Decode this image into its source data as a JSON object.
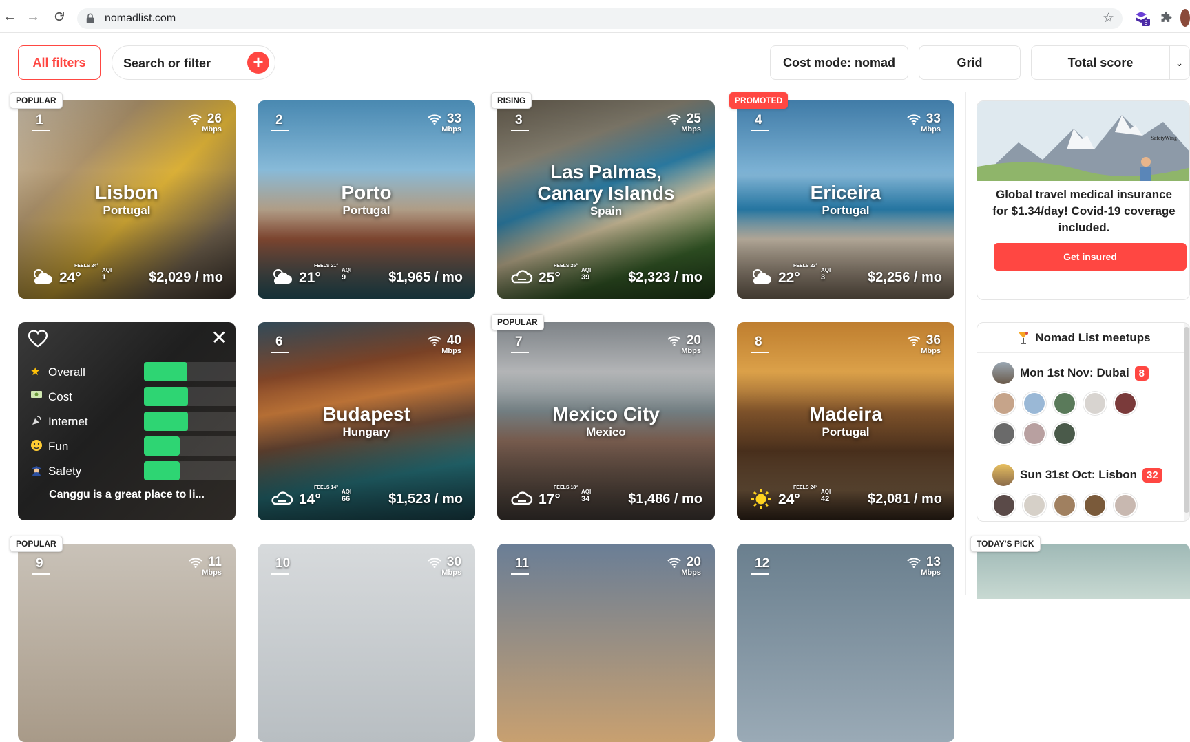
{
  "browser": {
    "url": "nomadlist.com",
    "ext_badge": "5"
  },
  "toolbar": {
    "all_filters": "All filters",
    "search_placeholder": "Search or filter",
    "cost_mode": "Cost mode: nomad",
    "view_mode": "Grid",
    "sort": "Total score"
  },
  "cities": [
    {
      "rank": "1",
      "name": "Lisbon",
      "country": "Portugal",
      "wifi": "26",
      "unit": "Mbps",
      "temp": "24°",
      "feels": "FEELS 24°",
      "aqi_label": "AQI",
      "aqi": "1",
      "price": "$2,029 / mo",
      "badge": "POPULAR",
      "weather": "partly-cloudy-icon"
    },
    {
      "rank": "2",
      "name": "Porto",
      "country": "Portugal",
      "wifi": "33",
      "unit": "Mbps",
      "temp": "21°",
      "feels": "FEELS 21°",
      "aqi_label": "AQI",
      "aqi": "9",
      "price": "$1,965 / mo",
      "badge": "",
      "weather": "partly-cloudy-icon"
    },
    {
      "rank": "3",
      "name": "Las Palmas, Canary Islands",
      "country": "Spain",
      "wifi": "25",
      "unit": "Mbps",
      "temp": "25°",
      "feels": "FEELS 25°",
      "aqi_label": "AQI",
      "aqi": "39",
      "price": "$2,323 / mo",
      "badge": "RISING",
      "weather": "cloud-icon"
    },
    {
      "rank": "4",
      "name": "Ericeira",
      "country": "Portugal",
      "wifi": "33",
      "unit": "Mbps",
      "temp": "22°",
      "feels": "FEELS 22°",
      "aqi_label": "AQI",
      "aqi": "3",
      "price": "$2,256 / mo",
      "badge": "PROMOTED",
      "weather": "partly-cloudy-icon"
    },
    {
      "rank": "6",
      "name": "Budapest",
      "country": "Hungary",
      "wifi": "40",
      "unit": "Mbps",
      "temp": "14°",
      "feels": "FEELS 14°",
      "aqi_label": "AQI",
      "aqi": "66",
      "price": "$1,523 / mo",
      "badge": "",
      "weather": "cloud-icon"
    },
    {
      "rank": "7",
      "name": "Mexico City",
      "country": "Mexico",
      "wifi": "20",
      "unit": "Mbps",
      "temp": "17°",
      "feels": "FEELS 18°",
      "aqi_label": "AQI",
      "aqi": "34",
      "price": "$1,486 / mo",
      "badge": "POPULAR",
      "weather": "cloud-icon"
    },
    {
      "rank": "8",
      "name": "Madeira",
      "country": "Portugal",
      "wifi": "36",
      "unit": "Mbps",
      "temp": "24°",
      "feels": "FEELS 24°",
      "aqi_label": "AQI",
      "aqi": "42",
      "price": "$2,081 / mo",
      "badge": "",
      "weather": "sun-icon"
    },
    {
      "rank": "9",
      "name": "",
      "country": "",
      "wifi": "11",
      "unit": "Mbps",
      "badge": "POPULAR"
    },
    {
      "rank": "10",
      "name": "",
      "country": "",
      "wifi": "30",
      "unit": "Mbps",
      "badge": ""
    },
    {
      "rank": "11",
      "name": "",
      "country": "",
      "wifi": "20",
      "unit": "Mbps",
      "badge": ""
    },
    {
      "rank": "12",
      "name": "",
      "country": "",
      "wifi": "13",
      "unit": "Mbps",
      "badge": ""
    }
  ],
  "hover_card": {
    "rows": [
      {
        "icon": "star-icon",
        "label": "Overall",
        "level": 0.45
      },
      {
        "icon": "money-icon",
        "label": "Cost",
        "level": 0.46
      },
      {
        "icon": "satellite-icon",
        "label": "Internet",
        "level": 0.46
      },
      {
        "icon": "smile-icon",
        "label": "Fun",
        "level": 0.37
      },
      {
        "icon": "police-icon",
        "label": "Safety",
        "level": 0.37
      }
    ],
    "caption": "Canggu is a great place to li..."
  },
  "sidebar": {
    "ad_text": "Global travel medical insurance for $1.34/day! Covid-19 coverage included.",
    "ad_button": "Get insured",
    "ad_brand": "SafetyWing",
    "meetups_title": "Nomad List meetups",
    "meetups": [
      {
        "title": "Mon 1st Nov: Dubai",
        "count": "8"
      },
      {
        "title": "Sun 31st Oct: Lisbon",
        "count": "32"
      }
    ],
    "todays_pick": "TODAY'S PICK"
  },
  "colors": {
    "accent": "#ff4742",
    "bar": "#2ed573"
  }
}
